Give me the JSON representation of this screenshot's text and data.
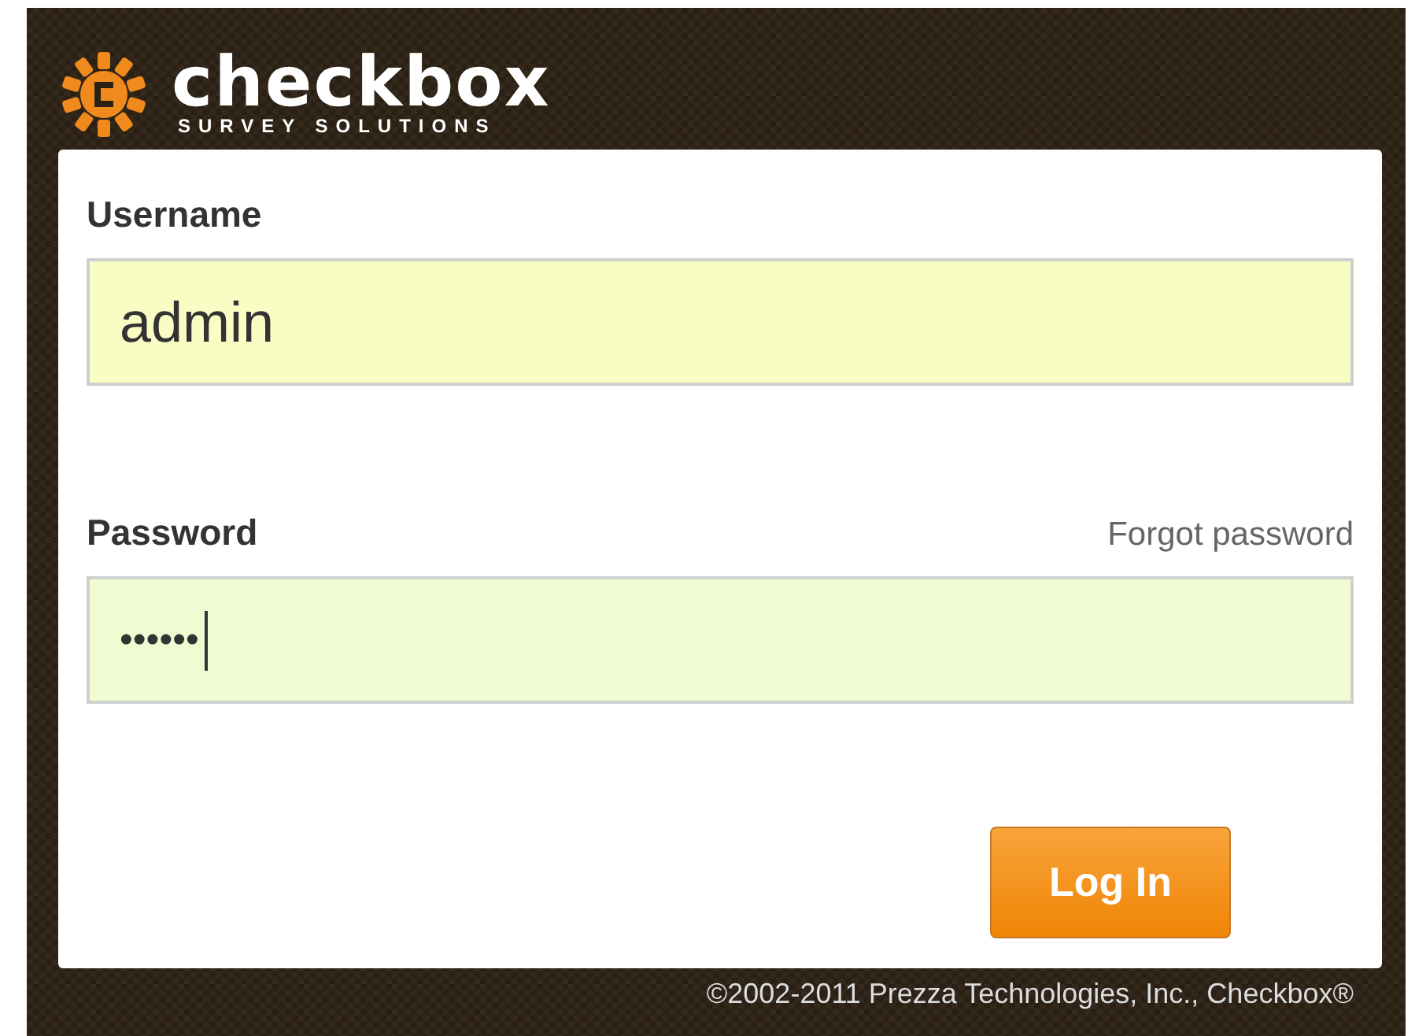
{
  "logo": {
    "name": "checkbox",
    "tagline": "SURVEY SOLUTIONS"
  },
  "form": {
    "fields": [
      {
        "label": "Username",
        "value": "admin",
        "focused": false
      },
      {
        "label": "Password",
        "value": "••••••",
        "focused": true,
        "link": "Forgot password"
      }
    ],
    "button": "Log In"
  },
  "footer": "©2002-2011 Prezza Technologies, Inc., Checkbox®"
}
